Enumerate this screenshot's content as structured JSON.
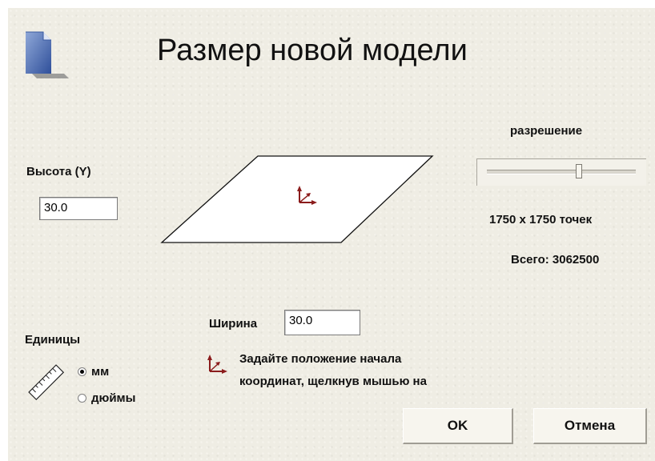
{
  "dialog": {
    "title": "Размер новой модели"
  },
  "height": {
    "label": "Высота (Y)",
    "value": "30.0"
  },
  "width": {
    "label": "Ширина",
    "value": "30.0"
  },
  "resolution": {
    "label": "разрешение",
    "slider_fraction": 0.62,
    "points": "1750 x 1750 точек",
    "total": "Всего: 3062500"
  },
  "units": {
    "label": "Единицы",
    "options": [
      {
        "label": "мм",
        "selected": true
      },
      {
        "label": "дюймы",
        "selected": false
      }
    ]
  },
  "hint": {
    "line1": "Задайте положение начала",
    "line2": "координат, щелкнув мышью на"
  },
  "buttons": {
    "ok": "OK",
    "cancel": "Отмена"
  },
  "icons": {
    "document": "document-icon",
    "origin": "origin-axes-icon",
    "ruler": "ruler-icon"
  },
  "colors": {
    "origin_marker": "#8b1c1c",
    "page_fold": "#4a66a8"
  }
}
